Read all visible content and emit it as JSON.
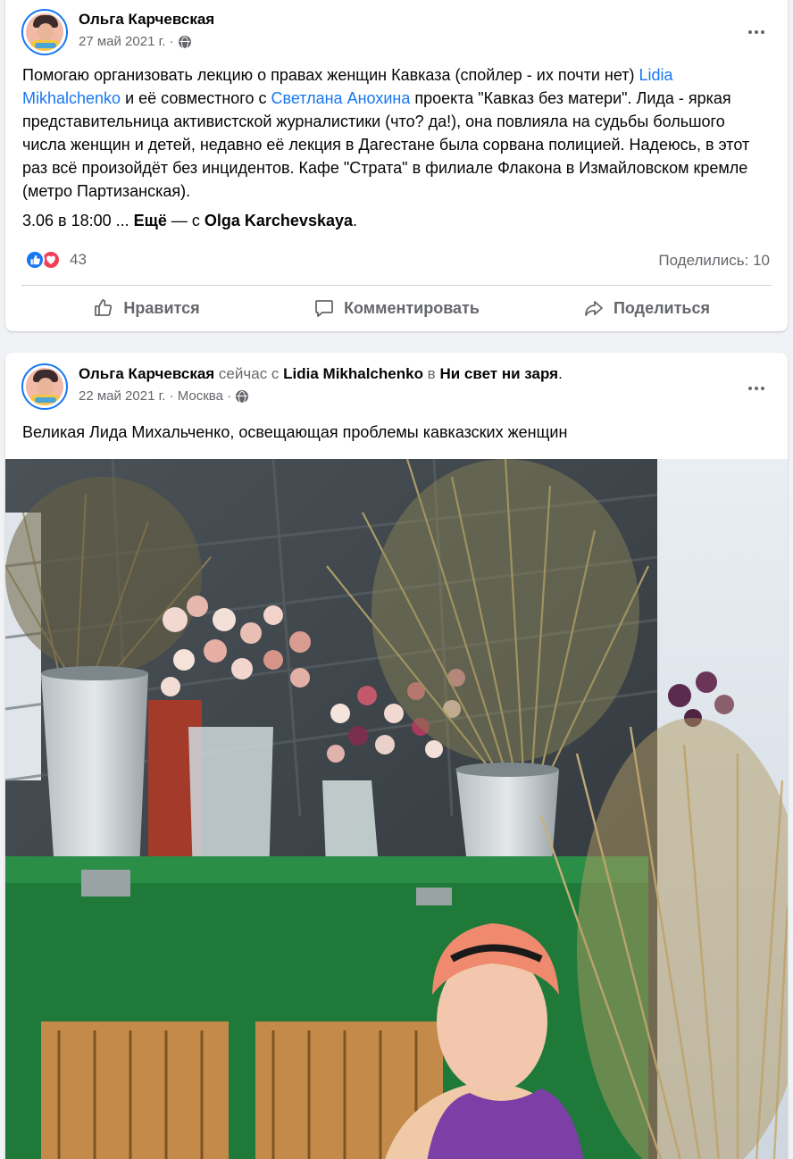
{
  "post1": {
    "author": "Ольга Карчевская",
    "date": "27 май 2021 г. ·",
    "text_part1": "Помогаю организовать лекцию о правах женщин Кавказа (спойлер - их почти нет) ",
    "mention1": "Lidia Mikhalchenko",
    "text_part2": " и её совместного с ",
    "mention2": "Светлана Анохина",
    "text_part3": " проекта \"Кавказ без матери\". Лида - яркая представительница активистской журналистики (что? да!), она повлияла на судьбы большого числа женщин и детей, недавно её лекция в Дагестане была сорвана полицией. Надеюсь, в этот раз всё произойдёт без инцидентов. Кафе \"Страта\" в филиале Флакона в Измайловском кремле (метро Партизанская).",
    "more_line_start": "3.06 в 18:00 ... ",
    "more_label": "Ещё",
    "more_with": " — с ",
    "tagged": "Olga Karchevskaya",
    "more_end": ".",
    "reaction_count": "43",
    "shares": "Поделились: 10",
    "actions": {
      "like": "Нравится",
      "comment": "Комментировать",
      "share": "Поделиться"
    }
  },
  "post2": {
    "author": "Ольга Карчевская",
    "now_with": " сейчас с ",
    "with_person": "Lidia Mikhalchenko",
    "in_word": " в ",
    "place": "Ни свет ни заря",
    "place_end": ".",
    "date": "22 май 2021 г. · Москва ·",
    "text": "Великая Лида Михальченко, освещающая проблемы кавказских женщин"
  },
  "icons": {
    "globe": "globe-icon",
    "more": "more-horizontal-icon",
    "like": "thumbs-up-icon",
    "comment": "comment-icon",
    "share": "share-arrow-icon",
    "reaction_like": "like-reaction-icon",
    "reaction_love": "love-reaction-icon"
  },
  "colors": {
    "link": "#1877f2",
    "muted": "#65676b",
    "like": "#1877f2",
    "love": "#f33e58"
  }
}
